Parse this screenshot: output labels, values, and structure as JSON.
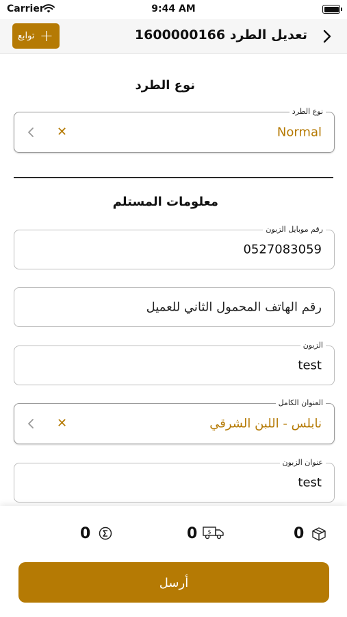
{
  "status_bar": {
    "carrier": "Carrier",
    "time": "9:44 AM"
  },
  "nav": {
    "title": "تعديل الطرد 1600000166",
    "add_label": "توابع"
  },
  "package_type": {
    "section_title": "نوع الطرد",
    "field_label": "نوع الطرد",
    "value": "Normal"
  },
  "recipient": {
    "section_title": "معلومات المستلم",
    "mobile": {
      "label": "رقم موبايل الزبون",
      "value": "0527083059"
    },
    "second_mobile": {
      "placeholder": "رقم الهاتف المحمول الثاني للعميل"
    },
    "customer": {
      "label": "الزبون",
      "value": "test"
    },
    "full_address": {
      "label": "العنوان الكامل",
      "value": "نابلس - اللبن الشرقي"
    },
    "customer_address": {
      "label": "عنوان الزبون",
      "value": "test"
    }
  },
  "footer": {
    "sum_value": "0",
    "delivery_value": "0",
    "packages_value": "0",
    "send_label": "أرسل"
  },
  "colors": {
    "accent": "#b57a04"
  },
  "icons": [
    "wifi-icon",
    "battery-icon",
    "back-chevron-icon",
    "plus-icon",
    "chevron-left-icon",
    "clear-icon",
    "sum-icon",
    "delivery-truck-icon",
    "package-box-icon"
  ]
}
